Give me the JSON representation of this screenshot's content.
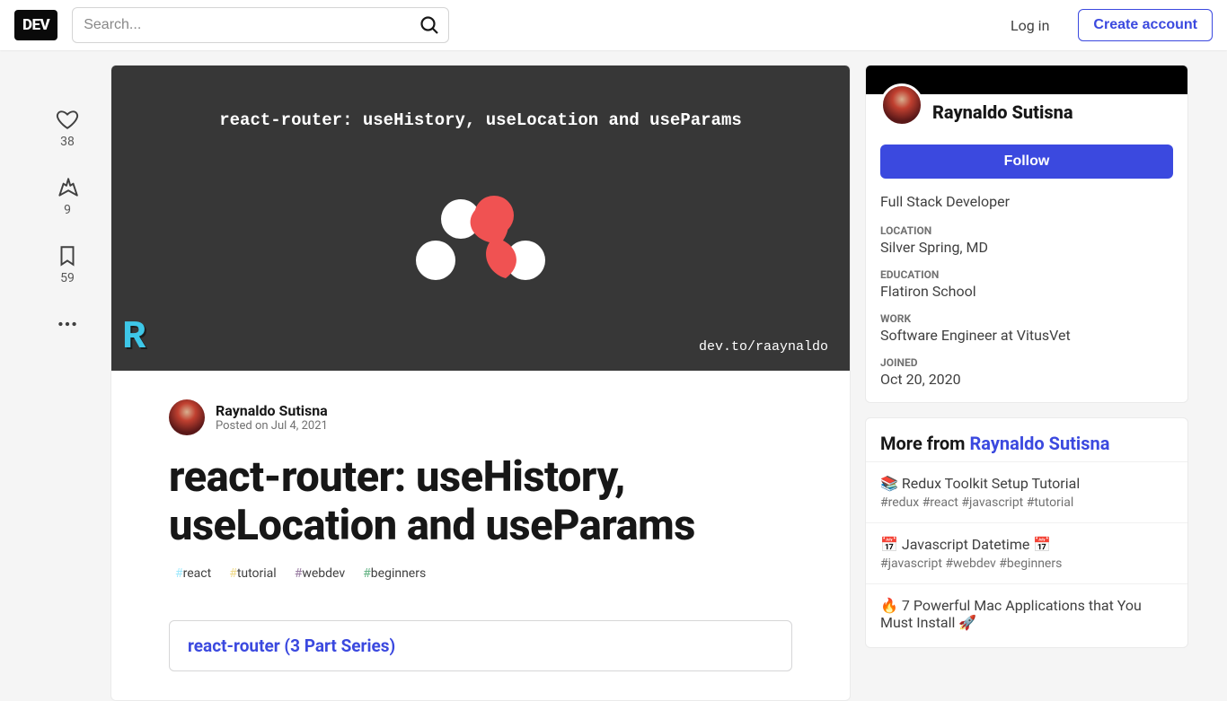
{
  "header": {
    "logo": "DEV",
    "search_placeholder": "Search...",
    "login": "Log in",
    "create_account": "Create account"
  },
  "reactions": {
    "like": "38",
    "unicorn": "9",
    "bookmark": "59"
  },
  "cover": {
    "text": "react-router: useHistory, useLocation and useParams",
    "credit": "dev.to/raaynaldo",
    "corner": "R"
  },
  "article": {
    "author": "Raynaldo Sutisna",
    "date_prefix": "Posted on ",
    "date": "Jul 4, 2021",
    "title": "react-router: useHistory, useLocation and useParams",
    "tags": [
      "react",
      "tutorial",
      "webdev",
      "beginners"
    ],
    "series_title": "react-router (3 Part Series)"
  },
  "author_card": {
    "name": "Raynaldo Sutisna",
    "follow": "Follow",
    "bio": "Full Stack Developer",
    "meta": [
      {
        "label": "LOCATION",
        "value": "Silver Spring, MD"
      },
      {
        "label": "EDUCATION",
        "value": "Flatiron School"
      },
      {
        "label": "WORK",
        "value": "Software Engineer at VitusVet"
      },
      {
        "label": "JOINED",
        "value": "Oct 20, 2020"
      }
    ]
  },
  "more": {
    "prefix": "More from ",
    "author": "Raynaldo Sutisna",
    "items": [
      {
        "title": "📚 Redux Toolkit Setup Tutorial",
        "tags": "#redux  #react  #javascript  #tutorial"
      },
      {
        "title": "📅 Javascript Datetime 📅",
        "tags": "#javascript  #webdev  #beginners"
      },
      {
        "title": "🔥 7 Powerful Mac Applications that You Must Install 🚀",
        "tags": ""
      }
    ]
  }
}
